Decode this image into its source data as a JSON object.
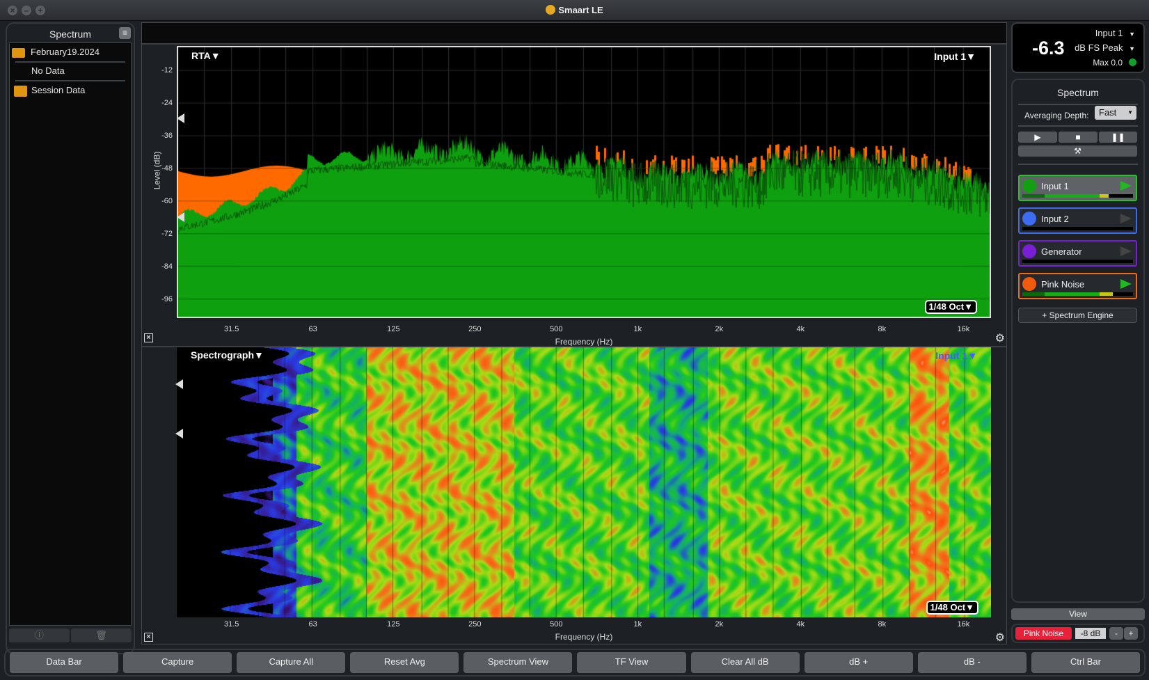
{
  "window": {
    "title": "Smaart LE"
  },
  "left_panel": {
    "title": "Spectrum",
    "items": [
      {
        "label": "February19.2024",
        "icon": "open-folder-icon"
      },
      {
        "label": "No Data"
      },
      {
        "label": "Session Data",
        "icon": "folder-icon"
      }
    ]
  },
  "rta": {
    "mode_label": "RTA▼",
    "input_label": "Input 1▼",
    "resolution": "1/48 Oct▼",
    "ylabel": "Level (dB)",
    "xlabel": "Frequency (Hz)",
    "yticks": [
      "-12",
      "-24",
      "-36",
      "-48",
      "-60",
      "-72",
      "-84",
      "-96"
    ],
    "xticks": [
      "31.5",
      "63",
      "125",
      "250",
      "500",
      "1k",
      "2k",
      "4k",
      "8k",
      "16k"
    ]
  },
  "spectrograph": {
    "mode_label": "Spectrograph▼",
    "input_label": "Input 1▼",
    "resolution": "1/48 Oct▼",
    "xlabel": "Frequency (Hz)",
    "xticks": [
      "31.5",
      "63",
      "125",
      "250",
      "500",
      "1k",
      "2k",
      "4k",
      "8k",
      "16k"
    ]
  },
  "meter": {
    "value": "-6.3",
    "input": "Input 1",
    "unit": "dB FS Peak",
    "max": "Max 0.0",
    "status_color": "#12a02a"
  },
  "spectrum_panel": {
    "title": "Spectrum",
    "avg_label": "Averaging Depth:",
    "avg_value": "Fast",
    "engines": [
      {
        "name": "Input 1",
        "color": "#12a012",
        "border": "#22c522",
        "active": true,
        "level": 0.78
      },
      {
        "name": "Input 2",
        "color": "#3d6cf0",
        "border": "#3d6cf0",
        "active": false,
        "level": 0
      },
      {
        "name": "Generator",
        "color": "#7b1fd6",
        "border": "#7b1fd6",
        "active": false,
        "level": 0
      },
      {
        "name": "Pink Noise",
        "color": "#f05a0a",
        "border": "#f06a1a",
        "active": true,
        "level": 0.82
      }
    ],
    "add_engine": "+ Spectrum Engine"
  },
  "view_button": "View",
  "generator": {
    "label": "Pink Noise",
    "level": "-8 dB",
    "minus": "-",
    "plus": "+"
  },
  "bottom_buttons": [
    "Data Bar",
    "Capture",
    "Capture All",
    "Reset Avg",
    "Spectrum View",
    "TF View",
    "Clear All dB",
    "dB +",
    "dB -",
    "Ctrl Bar"
  ],
  "colors": {
    "input1": "#0fa00f",
    "pink_noise": "#ff6a00"
  }
}
